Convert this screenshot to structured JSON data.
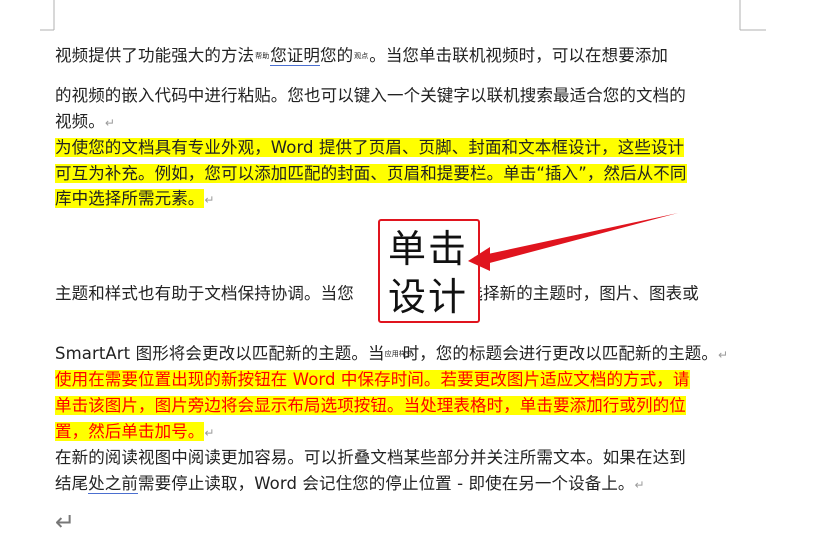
{
  "doc": {
    "p1": {
      "l1_a": "视频提供了功能强大的方法",
      "ruby_a": "帮助",
      "l1_u": "您证明",
      "l1_b": "您的",
      "ruby_b": "观点",
      "l1_c": "。当您单击联机视频时，可以在想要添加",
      "l2": "的视频的嵌入代码中进行粘贴。您也可以键入一个关键字以联机搜索最适合您的文档的",
      "l3": "视频。"
    },
    "p2": {
      "l1": "为使您的文档具有专业外观，Word 提供了页眉、页脚、封面和文本框设计，这些设计",
      "l2": "可互为补充。例如，您可以添加匹配的封面、页眉和提要栏。单击“插入”，然后从不同",
      "l3": "库中选择所需元素。"
    },
    "p3": {
      "l1_a": "主题和样式也有助于文档保持协调。当您",
      "l1_b": "并选择新的主题时，图片、图表或",
      "l2_a": "SmartArt 图形将会更改以匹配新的主题。当",
      "ruby": "应用样式",
      "l2_b": "时，您的标题会进行更改以匹配新的主题。"
    },
    "p4": {
      "l1": "使用在需要位置出现的新按钮在 Word 中保存时间。若要更改图片适应文档的方式，请",
      "l2": "单击该图片，图片旁边将会显示布局选项按钮。当处理表格时，单击要添加行或列的位",
      "l3": "置，然后单击加号。"
    },
    "p5": {
      "l1": "在新的阅读视图中阅读更加容易。可以折叠文档某些部分并关注所需文本。如果在达到",
      "l2_a": "结尾",
      "l2_u": "处之前",
      "l2_b": "需要停止读取，Word 会记住您的停止位置 - 即使在另一个设备上。"
    },
    "paragraph_mark": "↵",
    "final_mark": "↵"
  },
  "annotation": {
    "line1": "单击",
    "line2": "设计",
    "border_color": "#e0141e",
    "arrow_color": "#e0141e"
  },
  "highlight_color": "#ffff00",
  "highlight_text_red": "#ff0000"
}
